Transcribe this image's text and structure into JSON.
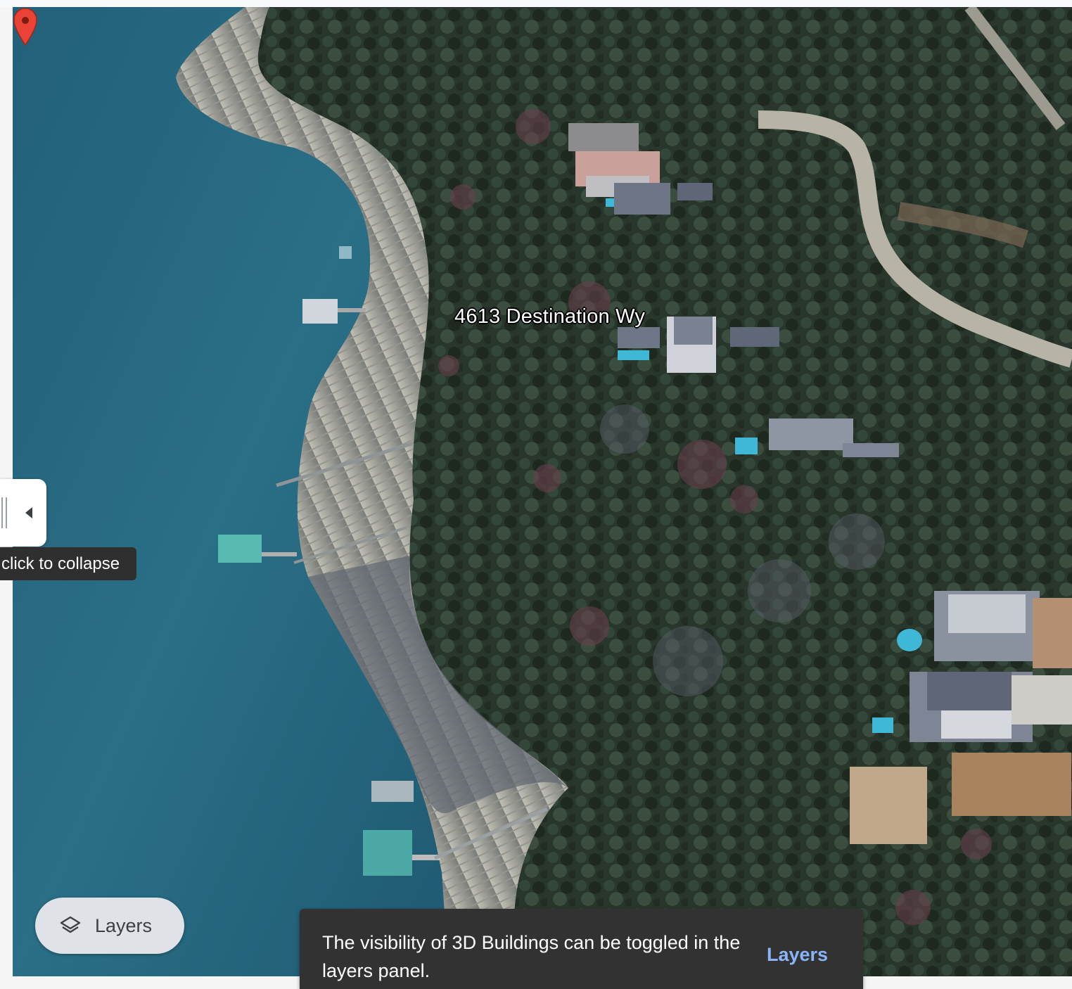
{
  "map": {
    "place_label": "4613 Destination Wy",
    "view": "3D satellite",
    "marker_icon": "red-location-pin-icon",
    "colors": {
      "water": "#2a6f86",
      "shore": "#a9a8a0",
      "trees": "#26342a",
      "pin": "#ea4335"
    }
  },
  "side_panel": {
    "handle_icon": "chevron-left-icon",
    "tooltip": "click to collapse"
  },
  "layers_button": {
    "icon": "layers-icon",
    "label": "Layers"
  },
  "snackbar": {
    "message": "The visibility of 3D Buildings can be toggled in the layers panel.",
    "action_label": "Layers",
    "action_color": "#8ab4f8"
  }
}
